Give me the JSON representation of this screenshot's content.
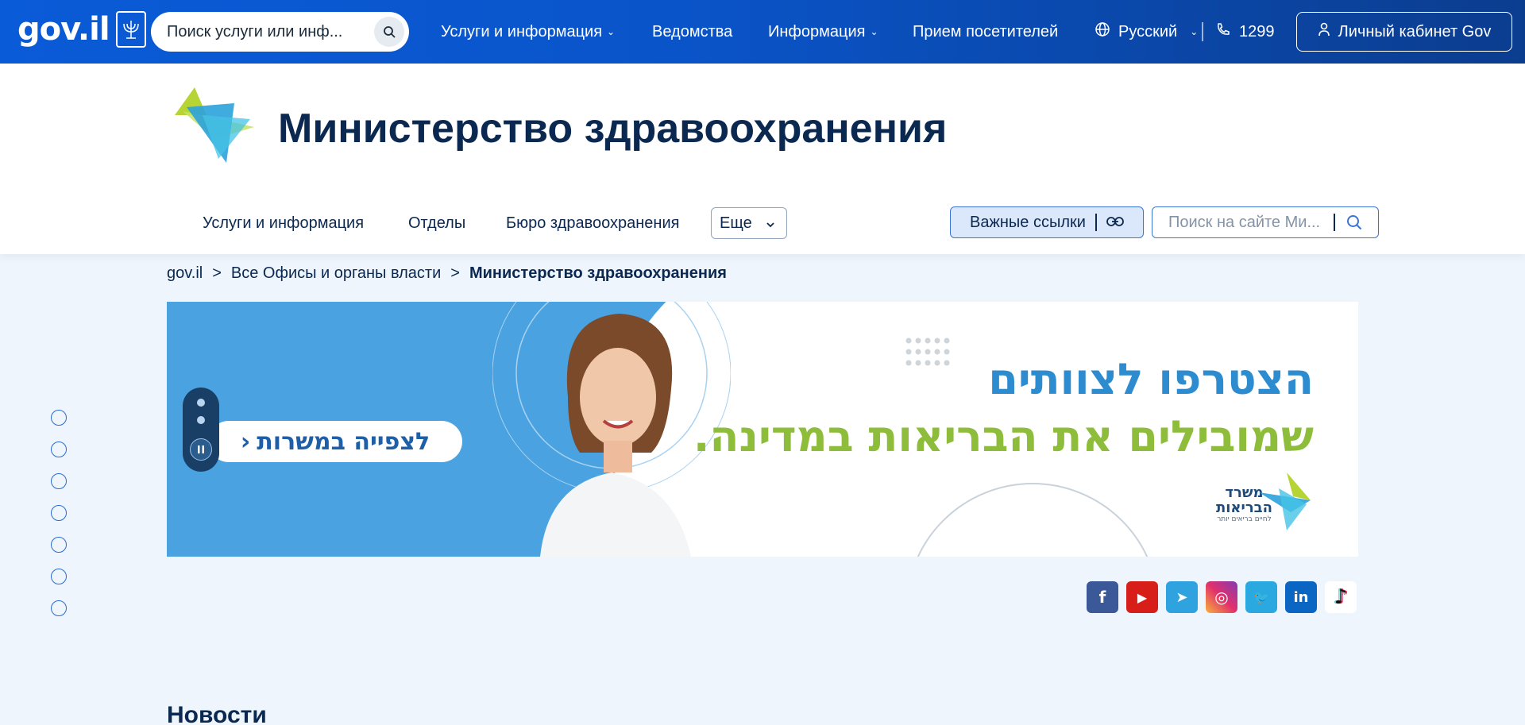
{
  "topbar": {
    "brand": "gov.il",
    "search_placeholder": "Поиск услуги или инф...",
    "nav": {
      "services": "Услуги и информация",
      "departments": "Ведомства",
      "information": "Информация",
      "reception": "Прием посетителей"
    },
    "language": "Русский",
    "phone": "1299",
    "cabinet_label": "Личный кабинет Gov"
  },
  "ministry": {
    "title": "Министерство здравоохранения",
    "subnav": {
      "services": "Услуги и информация",
      "departments": "Отделы",
      "bureau": "Бюро здравоохранения",
      "more": "Еще"
    },
    "links_label": "Важные ссылки",
    "search_placeholder": "Поиск на сайте Ми..."
  },
  "breadcrumb": {
    "home": "gov.il",
    "offices": "Все Офисы и органы власти",
    "current": "Министерство здравоохранения",
    "separator": ">"
  },
  "banner": {
    "cta": "לצפייה במשרות",
    "headline_1": "הצטרפו לצוותים",
    "headline_2": "שמובילים את הבריאות במדינה.",
    "logo_text_1": "משרד",
    "logo_text_2": "הבריאות",
    "logo_tagline": "לחיים בריאים יותר",
    "colors": {
      "blue": "#4aa3e0",
      "green": "#8dbd3a",
      "headline_blue": "#2d8bd0"
    }
  },
  "side_nav_count": 7,
  "social": [
    {
      "name": "facebook",
      "glyph": "f",
      "color": "#3b5998"
    },
    {
      "name": "youtube",
      "glyph": "▶",
      "color": "#d71e18"
    },
    {
      "name": "telegram",
      "glyph": "➤",
      "color": "#2fa3e0"
    },
    {
      "name": "instagram",
      "glyph": "◎",
      "color": "#d6336c"
    },
    {
      "name": "twitter",
      "glyph": "🐦",
      "color": "#2aa9e0"
    },
    {
      "name": "linkedin",
      "glyph": "in",
      "color": "#0a66c2"
    },
    {
      "name": "tiktok",
      "glyph": "♪",
      "color": "#ffffff"
    }
  ],
  "news_heading": "Новости"
}
